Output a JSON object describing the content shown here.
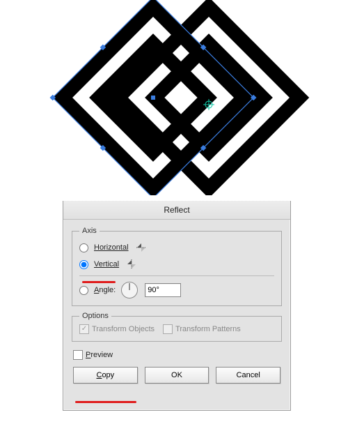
{
  "dialog": {
    "title": "Reflect",
    "axis": {
      "legend": "Axis",
      "horizontal_label": "Horizontal",
      "vertical_label": "Vertical",
      "angle_label": "Angle:",
      "angle_value": "90°",
      "selected": "vertical"
    },
    "options": {
      "legend": "Options",
      "transform_objects_label": "Transform Objects",
      "transform_objects_checked": true,
      "transform_patterns_label": "Transform Patterns",
      "transform_patterns_checked": false,
      "enabled": false
    },
    "preview": {
      "label": "Preview",
      "checked": false
    },
    "buttons": {
      "copy": "Copy",
      "ok": "OK",
      "cancel": "Cancel"
    }
  }
}
